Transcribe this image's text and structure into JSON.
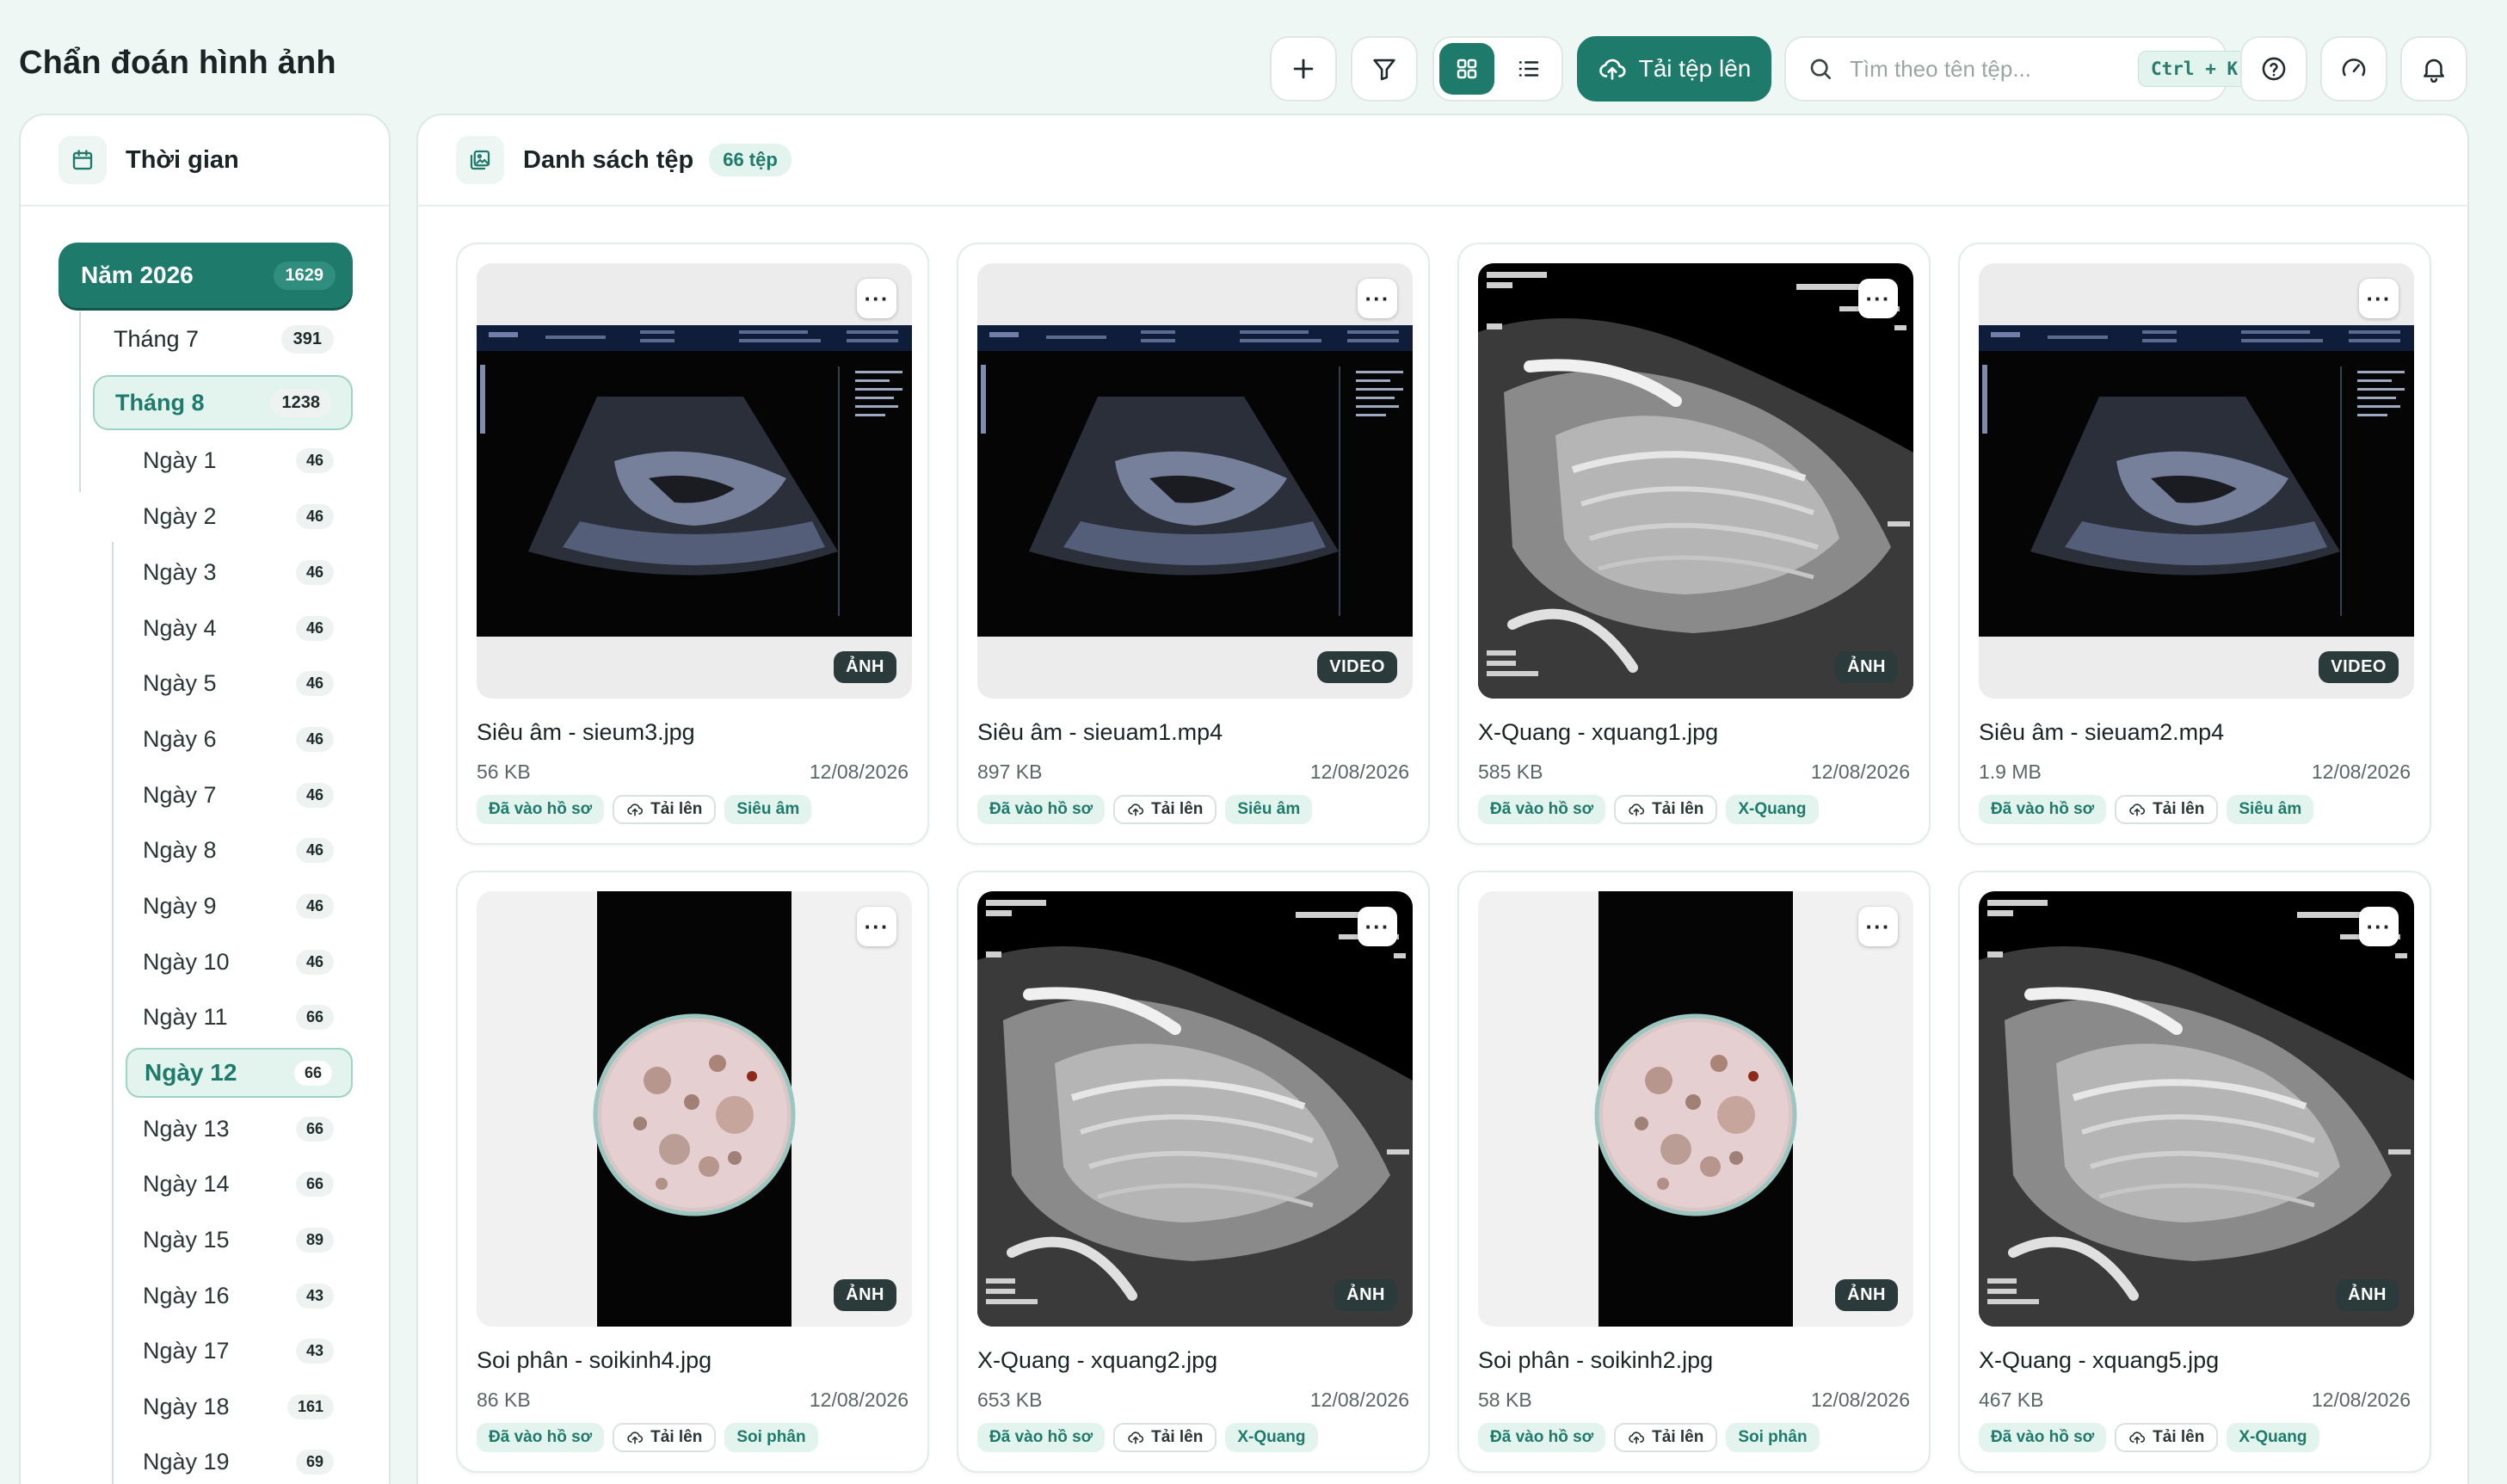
{
  "header": {
    "title": "Chẩn đoán hình ảnh",
    "upload_label": "Tải tệp lên",
    "search_placeholder": "Tìm theo tên tệp...",
    "search_shortcut": "Ctrl + K"
  },
  "sidebar": {
    "title": "Thời gian",
    "year": {
      "label": "Năm 2026",
      "count": "1629"
    },
    "months": [
      {
        "label": "Tháng 7",
        "count": "391"
      },
      {
        "label": "Tháng 8",
        "count": "1238"
      }
    ],
    "days": [
      {
        "label": "Ngày 1",
        "count": "46"
      },
      {
        "label": "Ngày 2",
        "count": "46"
      },
      {
        "label": "Ngày 3",
        "count": "46"
      },
      {
        "label": "Ngày 4",
        "count": "46"
      },
      {
        "label": "Ngày 5",
        "count": "46"
      },
      {
        "label": "Ngày 6",
        "count": "46"
      },
      {
        "label": "Ngày 7",
        "count": "46"
      },
      {
        "label": "Ngày 8",
        "count": "46"
      },
      {
        "label": "Ngày 9",
        "count": "46"
      },
      {
        "label": "Ngày 10",
        "count": "46"
      },
      {
        "label": "Ngày 11",
        "count": "66"
      },
      {
        "label": "Ngày 12",
        "count": "66"
      },
      {
        "label": "Ngày 13",
        "count": "66"
      },
      {
        "label": "Ngày 14",
        "count": "66"
      },
      {
        "label": "Ngày 15",
        "count": "89"
      },
      {
        "label": "Ngày 16",
        "count": "43"
      },
      {
        "label": "Ngày 17",
        "count": "43"
      },
      {
        "label": "Ngày 18",
        "count": "161"
      },
      {
        "label": "Ngày 19",
        "count": "69"
      }
    ]
  },
  "main": {
    "title": "Danh sách tệp",
    "count_label": "66 tệp",
    "files": [
      {
        "name": "Siêu âm - sieum3.jpg",
        "size": "56 KB",
        "date": "12/08/2026",
        "type": "ẢNH",
        "status": "Đã vào hồ sơ",
        "upload": "Tải lên",
        "category": "Siêu âm",
        "kind": "ultrasound"
      },
      {
        "name": "Siêu âm - sieuam1.mp4",
        "size": "897 KB",
        "date": "12/08/2026",
        "type": "VIDEO",
        "status": "Đã vào hồ sơ",
        "upload": "Tải lên",
        "category": "Siêu âm",
        "kind": "ultrasound"
      },
      {
        "name": "X-Quang - xquang1.jpg",
        "size": "585 KB",
        "date": "12/08/2026",
        "type": "ẢNH",
        "status": "Đã vào hồ sơ",
        "upload": "Tải lên",
        "category": "X-Quang",
        "kind": "xray"
      },
      {
        "name": "Siêu âm - sieuam2.mp4",
        "size": "1.9 MB",
        "date": "12/08/2026",
        "type": "VIDEO",
        "status": "Đã vào hồ sơ",
        "upload": "Tải lên",
        "category": "Siêu âm",
        "kind": "ultrasound"
      },
      {
        "name": "Soi phân - soikinh4.jpg",
        "size": "86 KB",
        "date": "12/08/2026",
        "type": "ẢNH",
        "status": "Đã vào hồ sơ",
        "upload": "Tải lên",
        "category": "Soi phân",
        "kind": "microscope"
      },
      {
        "name": "X-Quang - xquang2.jpg",
        "size": "653 KB",
        "date": "12/08/2026",
        "type": "ẢNH",
        "status": "Đã vào hồ sơ",
        "upload": "Tải lên",
        "category": "X-Quang",
        "kind": "xray"
      },
      {
        "name": "Soi phân - soikinh2.jpg",
        "size": "58 KB",
        "date": "12/08/2026",
        "type": "ẢNH",
        "status": "Đã vào hồ sơ",
        "upload": "Tải lên",
        "category": "Soi phân",
        "kind": "microscope"
      },
      {
        "name": "X-Quang - xquang5.jpg",
        "size": "467 KB",
        "date": "12/08/2026",
        "type": "ẢNH",
        "status": "Đã vào hồ sơ",
        "upload": "Tải lên",
        "category": "X-Quang",
        "kind": "xray"
      }
    ]
  },
  "colors": {
    "accent": "#1e7a6a",
    "accent_soft": "#e3f3ee",
    "background": "#eef7f4"
  }
}
